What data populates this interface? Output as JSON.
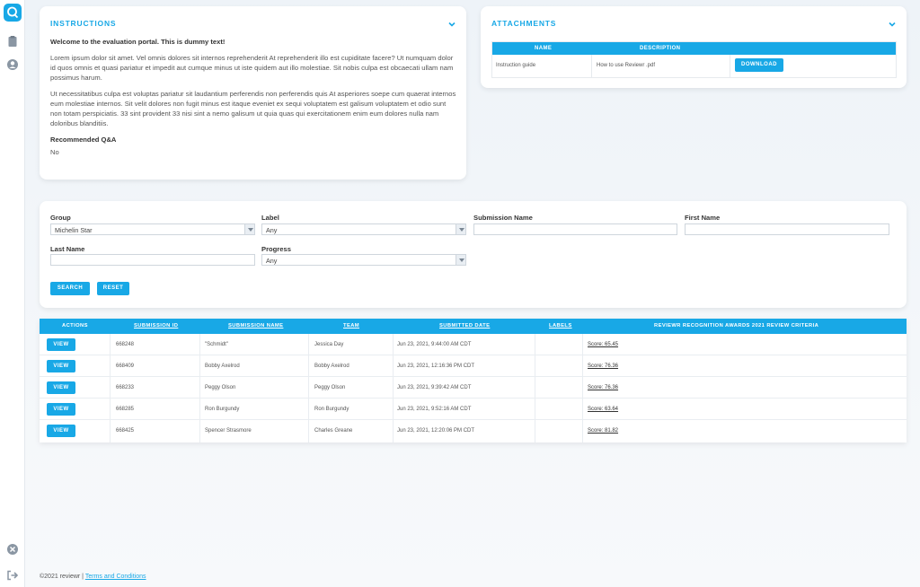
{
  "instructions": {
    "title": "INSTRUCTIONS",
    "welcome": "Welcome to the evaluation portal. This is dummy text!",
    "para1": "Lorem ipsum dolor sit amet. Vel omnis dolores sit internos reprehenderit At reprehenderit illo est cupiditate facere? Ut numquam dolor id quos omnis et quasi pariatur et impedit aut cumque minus ut iste quidem aut illo molestiae. Sit nobis culpa est obcaecati ullam nam possimus harum.",
    "para2": "Ut necessitatibus culpa est voluptas pariatur sit laudantium perferendis non perferendis quis At asperiores soepe cum quaerat internos eum molestiae internos. Sit velit dolores non fugit minus est itaque eveniet ex sequi voluptatem est galisum voluptatem et odio sunt non totam perspiciatis. 33 sint provident 33 nisi sint a nemo galisum ut quia quas qui exercitationem enim eum dolores nulla nam doloribus blanditiis.",
    "recommended_label": "Recommended Q&A",
    "recommended_value": "No"
  },
  "attachments": {
    "title": "ATTACHMENTS",
    "col_name": "NAME",
    "col_description": "DESCRIPTION",
    "row_name": "Instruction guide",
    "row_description": "How to use Reviewr .pdf",
    "download_label": "DOWNLOAD"
  },
  "filters": {
    "group_label": "Group",
    "group_value": "Michelin Star",
    "label_label": "Label",
    "label_value": "Any",
    "submission_name_label": "Submission Name",
    "first_name_label": "First Name",
    "last_name_label": "Last Name",
    "progress_label": "Progress",
    "progress_value": "Any",
    "search_label": "SEARCH",
    "reset_label": "RESET"
  },
  "table": {
    "headers": {
      "actions": "ACTIONS",
      "submission_id": "SUBMISSION ID",
      "submission_name": "SUBMISSION NAME",
      "team": "TEAM",
      "submitted_date": "SUBMITTED DATE",
      "labels": "LABELS",
      "criteria": "REVIEWR RECOGNITION AWARDS 2021 REVIEW CRITERIA"
    },
    "view_label": "VIEW",
    "rows": [
      {
        "id": "668248",
        "name": "\"Schmidt\"",
        "team": "Jessica Day",
        "date": "Jun 23, 2021, 9:44:00 AM CDT",
        "score": "Score: 65.45"
      },
      {
        "id": "668409",
        "name": "Bobby Axelrod",
        "team": "Bobby Axelrod",
        "date": "Jun 23, 2021, 12:16:36 PM CDT",
        "score": "Score: 76.36"
      },
      {
        "id": "668233",
        "name": "Peggy Olson",
        "team": "Peggy Olson",
        "date": "Jun 23, 2021, 9:39:42 AM CDT",
        "score": "Score: 76.36"
      },
      {
        "id": "668285",
        "name": "Ron Burgundy",
        "team": "Ron Burgundy",
        "date": "Jun 23, 2021, 9:52:16 AM CDT",
        "score": "Score: 63.64"
      },
      {
        "id": "668425",
        "name": "Spencer Strasmore",
        "team": "Charles Greane",
        "date": "Jun 23, 2021, 12:20:06 PM CDT",
        "score": "Score: 81.82"
      }
    ]
  },
  "footer": {
    "copyright": "©2021 reviewr |",
    "terms_label": "Terms and Conditions"
  },
  "colors": {
    "accent": "#18a8e6"
  }
}
